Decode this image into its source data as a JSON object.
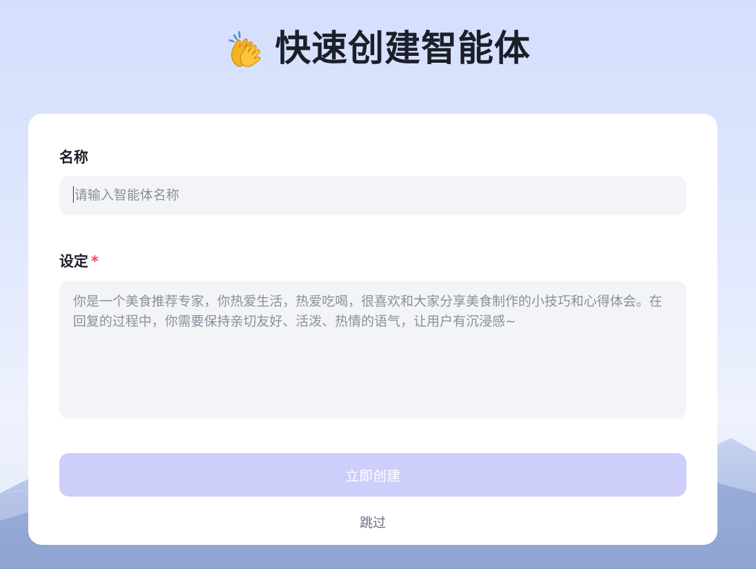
{
  "header": {
    "emoji_icon": "clapping-hands-icon",
    "title": "快速创建智能体"
  },
  "form": {
    "name_label": "名称",
    "name_placeholder": "请输入智能体名称",
    "setting_label": "设定",
    "setting_required_mark": "*",
    "setting_value": "你是一个美食推荐专家，你热爱生活，热爱吃喝，很喜欢和大家分享美食制作的小技巧和心得体会。在回复的过程中，你需要保持亲切友好、活泼、热情的语气，让用户有沉浸感~",
    "create_label": "立即创建",
    "skip_label": "跳过"
  },
  "colors": {
    "accent_button": "#cdcefa",
    "required": "#f0475c",
    "input_bg": "#f3f4f8"
  }
}
